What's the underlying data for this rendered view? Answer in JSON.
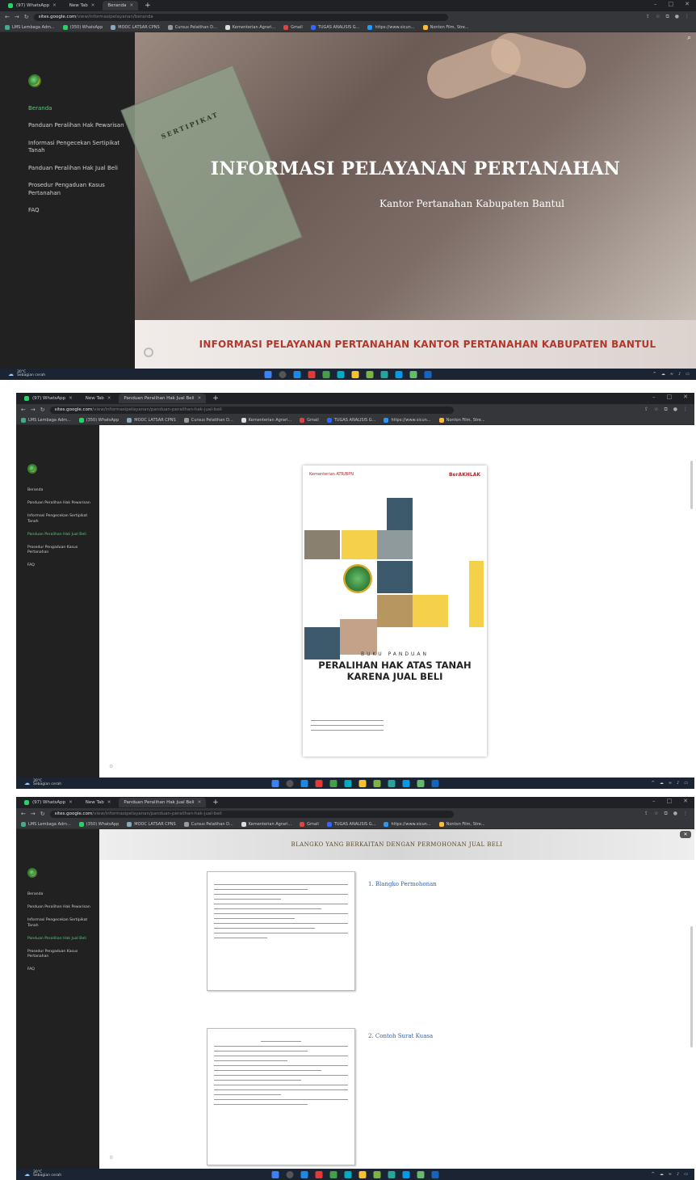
{
  "browser": {
    "tabs": [
      {
        "label": "(97) WhatsApp"
      },
      {
        "label": "New Tab"
      },
      {
        "label": "Beranda"
      }
    ],
    "tabs_doc": [
      {
        "label": "(97) WhatsApp"
      },
      {
        "label": "New Tab"
      },
      {
        "label": "Panduan Peralihan Hak Jual Beli"
      }
    ],
    "url_host": "sites.google.com",
    "bookmarks": [
      "LMS Lembaga Adm...",
      "(350) WhatsApp",
      "MOOC LATSAR CPNS",
      "Cursus Pelatihan D...",
      "Kementerian Agrari...",
      "Gmail",
      "TUGAS ANALISIS G...",
      "https://www.sicun...",
      "Nonton Film, Stre..."
    ]
  },
  "sidebar": {
    "items": [
      {
        "label": "Beranda"
      },
      {
        "label": "Panduan Peralihan Hak Pewarisan"
      },
      {
        "label": "Informasi Pengecekan Sertipikat Tanah"
      },
      {
        "label": "Panduan Peralihan Hak Jual Beli"
      },
      {
        "label": "Prosedur Pengaduan Kasus Pertanahan"
      },
      {
        "label": "FAQ"
      }
    ]
  },
  "hero": {
    "title": "INFORMASI PELAYANAN PERTANAHAN",
    "subtitle": "Kantor Pertanahan Kabupaten Bantul",
    "banner": "INFORMASI PELAYANAN PERTANAHAN KANTOR PERTANAHAN KABUPATEN BANTUL",
    "doc_label": "SERTIPIKAT"
  },
  "book": {
    "kicker": "BUKU PANDUAN",
    "title_line1": "PERALIHAN HAK ATAS TANAH",
    "title_line2": "KARENA JUAL BELI",
    "brand": "BerAKHLAK",
    "brand_left": "Kementerian ATR/BPN"
  },
  "blanko": {
    "header": "BLANGKO YANG BERKAITAN DENGAN PERMOHONAN JUAL BELI",
    "item1": "1. Blangko Permohonan",
    "item2": "2. Contoh Surat Kuasa"
  },
  "taskbar": {
    "weather_temp": "30°C",
    "weather_desc": "Sebagian cerah"
  },
  "colors": {
    "active_nav": "#5cc97a",
    "banner_text": "#b4372c",
    "book_blue": "#3d5a6c",
    "book_yellow": "#f5d04a"
  }
}
